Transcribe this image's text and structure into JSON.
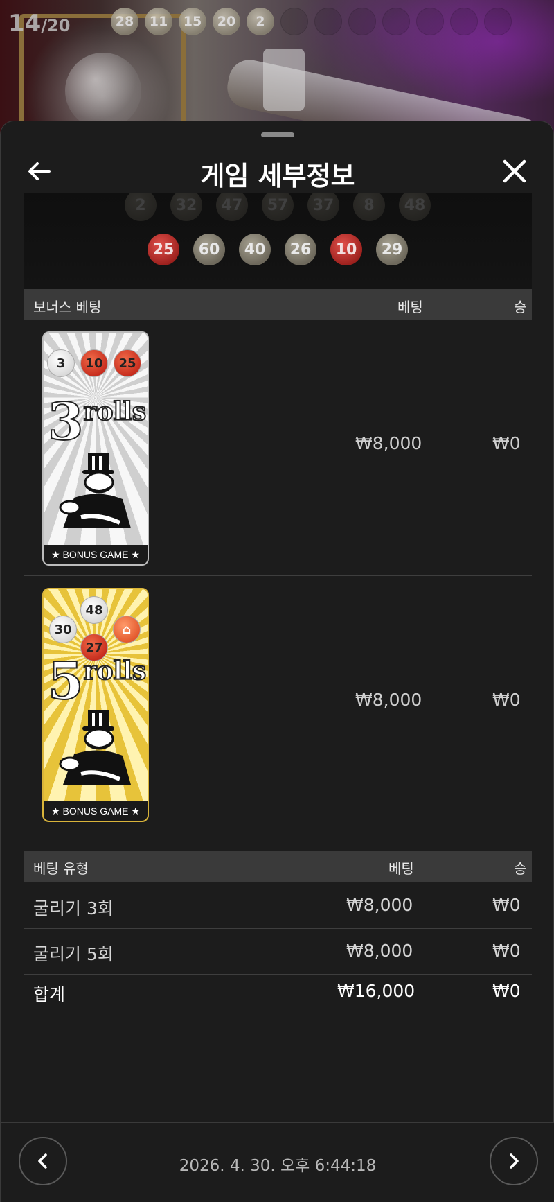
{
  "background": {
    "round_current": "14",
    "round_total": "/20",
    "drawn_balls": [
      "28",
      "11",
      "15",
      "20",
      "2"
    ],
    "empty_slots": 7
  },
  "sheet": {
    "title": "게임 세부정보",
    "result_rows": [
      [
        "2",
        "32",
        "47",
        "57",
        "37",
        "8",
        "48"
      ],
      [
        {
          "n": "25",
          "color": "red"
        },
        {
          "n": "60",
          "color": "grey"
        },
        {
          "n": "40",
          "color": "grey"
        },
        {
          "n": "26",
          "color": "grey"
        },
        {
          "n": "10",
          "color": "red"
        },
        {
          "n": "29",
          "color": "grey"
        }
      ]
    ],
    "bonus_table": {
      "col_type": "보너스 베팅",
      "col_bet": "베팅",
      "col_win": "승",
      "rows": [
        {
          "card": "silver",
          "card_number": "3",
          "card_word": "rolls",
          "card_balls": [
            "3",
            "10",
            "25"
          ],
          "ribbon": "★ BONUS GAME ★",
          "bet": "₩8,000",
          "win": "₩0"
        },
        {
          "card": "gold",
          "card_number": "5",
          "card_word": "rolls",
          "card_balls": [
            "48",
            "30",
            "27"
          ],
          "ribbon": "★ BONUS GAME ★",
          "bet": "₩8,000",
          "win": "₩0"
        }
      ]
    },
    "bet_type_table": {
      "col_type": "베팅 유형",
      "col_bet": "베팅",
      "col_win": "승",
      "rows": [
        {
          "type": "굴리기 3회",
          "bet": "₩8,000",
          "win": "₩0"
        },
        {
          "type": "굴리기 5회",
          "bet": "₩8,000",
          "win": "₩0"
        }
      ],
      "total": {
        "type": "합계",
        "bet": "₩16,000",
        "win": "₩0"
      }
    },
    "footer": {
      "timestamp": "2026. 4. 30. 오후 6:44:18"
    }
  },
  "colors": {
    "sheet_bg": "#1c1c1c",
    "table_header_bg": "#3a3a3a",
    "ball_red": "#c0302a",
    "ball_grey": "#8a8473",
    "card_silver": "#d8d8d8",
    "card_gold": "#e7c33a"
  },
  "icons": [
    "back-arrow-icon",
    "close-icon",
    "chevron-left-icon",
    "chevron-right-icon",
    "house-icon",
    "mascot-icon",
    "star-icon"
  ]
}
